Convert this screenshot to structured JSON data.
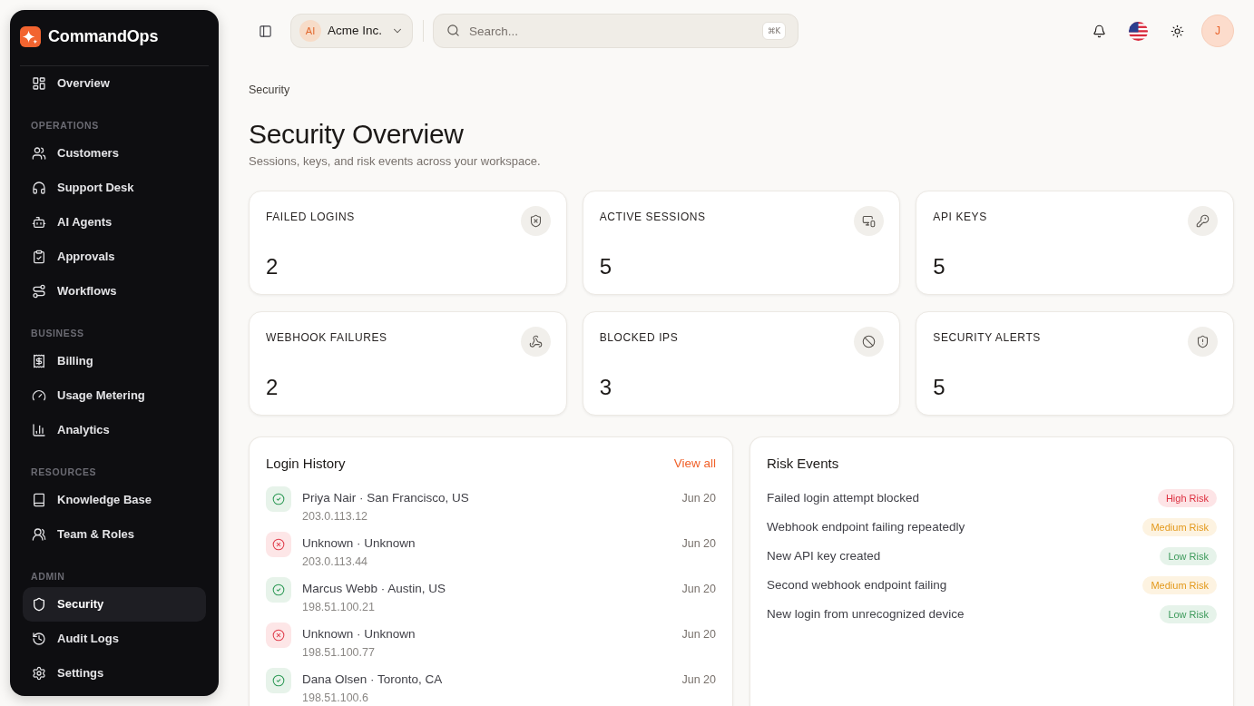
{
  "sidebar": {
    "brand": "CommandOps",
    "groups": [
      {
        "items": [
          {
            "label": "Overview",
            "selected": false
          }
        ]
      },
      {
        "heading": "OPERATIONS",
        "items": [
          {
            "label": "Customers",
            "selected": false
          },
          {
            "label": "Support Desk",
            "selected": false
          },
          {
            "label": "AI Agents",
            "selected": false
          },
          {
            "label": "Approvals",
            "selected": false
          },
          {
            "label": "Workflows",
            "selected": false
          }
        ]
      },
      {
        "heading": "BUSINESS",
        "items": [
          {
            "label": "Billing",
            "selected": false
          },
          {
            "label": "Usage Metering",
            "selected": false
          },
          {
            "label": "Analytics",
            "selected": false
          }
        ]
      },
      {
        "heading": "RESOURCES",
        "items": [
          {
            "label": "Knowledge Base",
            "selected": false
          },
          {
            "label": "Team & Roles",
            "selected": false
          }
        ]
      },
      {
        "heading": "ADMIN",
        "items": [
          {
            "label": "Security",
            "selected": true
          },
          {
            "label": "Audit Logs",
            "selected": false
          },
          {
            "label": "Settings",
            "selected": false
          }
        ]
      }
    ]
  },
  "header": {
    "org": {
      "initials": "AI",
      "name": "Acme Inc."
    },
    "search": {
      "placeholder": "Search...",
      "shortcut": "⌘K"
    },
    "user": {
      "initial": "J"
    }
  },
  "breadcrumb": "Security",
  "title": "Security Overview",
  "subtitle": "Sessions, keys, and risk events across your workspace.",
  "stats": [
    {
      "label": "FAILED LOGINS",
      "value": "2"
    },
    {
      "label": "ACTIVE SESSIONS",
      "value": "5"
    },
    {
      "label": "API KEYS",
      "value": "5"
    },
    {
      "label": "WEBHOOK FAILURES",
      "value": "2"
    },
    {
      "label": "BLOCKED IPS",
      "value": "3"
    },
    {
      "label": "SECURITY ALERTS",
      "value": "5"
    }
  ],
  "login_history": {
    "title": "Login History",
    "link": "View all",
    "rows": [
      {
        "kind": "success",
        "name": "Priya Nair · San Francisco, US",
        "ip": "203.0.113.12",
        "date": "Jun 20"
      },
      {
        "kind": "failed",
        "name": "Unknown · Unknown",
        "ip": "203.0.113.44",
        "date": "Jun 20"
      },
      {
        "kind": "success",
        "name": "Marcus Webb · Austin, US",
        "ip": "198.51.100.21",
        "date": "Jun 20"
      },
      {
        "kind": "failed",
        "name": "Unknown · Unknown",
        "ip": "198.51.100.77",
        "date": "Jun 20"
      },
      {
        "kind": "success",
        "name": "Dana Olsen · Toronto, CA",
        "ip": "198.51.100.6",
        "date": "Jun 20"
      }
    ]
  },
  "risk_events": {
    "title": "Risk Events",
    "rows": [
      {
        "event": "Failed login attempt blocked",
        "risk": "High Risk",
        "kind": "high"
      },
      {
        "event": "Webhook endpoint failing repeatedly",
        "risk": "Medium Risk",
        "kind": "medium"
      },
      {
        "event": "New API key created",
        "risk": "Low Risk",
        "kind": "low"
      },
      {
        "event": "Second webhook endpoint failing",
        "risk": "Medium Risk",
        "kind": "medium"
      },
      {
        "event": "New login from unrecognized device",
        "risk": "Low Risk",
        "kind": "low"
      }
    ]
  }
}
